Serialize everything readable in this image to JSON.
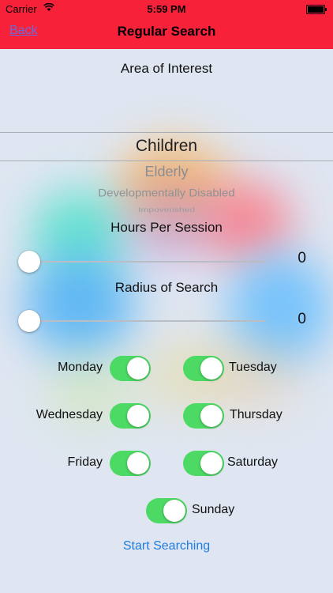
{
  "status_bar": {
    "carrier": "Carrier",
    "wifi_icon": "wifi-icon",
    "time": "5:59 PM",
    "battery_icon": "battery-icon"
  },
  "nav": {
    "back_label": "Back",
    "title": "Regular Search",
    "bar_color": "#f7223a"
  },
  "area_of_interest": {
    "label": "Area of Interest",
    "options": [
      "Children",
      "Elderly",
      "Developmentally Disabled",
      "Impoverished"
    ],
    "selected": "Children"
  },
  "hours_per_session": {
    "label": "Hours Per Session",
    "value": "0",
    "level": 0
  },
  "radius_of_search": {
    "label": "Radius of Search",
    "value": "0",
    "level": 0
  },
  "days": {
    "monday": {
      "label": "Monday",
      "on": true
    },
    "tuesday": {
      "label": "Tuesday",
      "on": true
    },
    "wednesday": {
      "label": "Wednesday",
      "on": true
    },
    "thursday": {
      "label": "Thursday",
      "on": true
    },
    "friday": {
      "label": "Friday",
      "on": true
    },
    "saturday": {
      "label": "Saturday",
      "on": true
    },
    "sunday": {
      "label": "Sunday",
      "on": true
    }
  },
  "start_button": {
    "label": "Start Searching"
  },
  "colors": {
    "switch_on": "#4cd964",
    "link": "#1f7ce0"
  }
}
